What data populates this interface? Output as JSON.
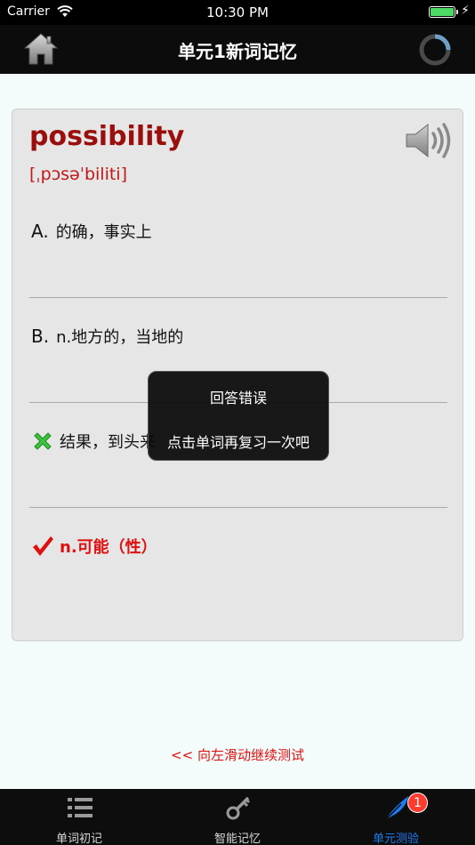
{
  "status_bar": {
    "carrier": "Carrier",
    "time": "10:30 PM",
    "charging_glyph": "⚡"
  },
  "nav": {
    "title": "单元1新词记忆",
    "home_icon": "house-icon",
    "progress_icon": "progress-ring-icon"
  },
  "card": {
    "word": "possibility",
    "phonetic": "[ˌpɔsəˈbiliti]",
    "speaker_icon": "speaker-icon",
    "options": [
      {
        "letter": "A.",
        "text": "的确，事实上",
        "state": "normal"
      },
      {
        "letter": "B.",
        "text": "n.地方的，当地的",
        "state": "normal"
      },
      {
        "letter": "",
        "text": "结果，到头来",
        "state": "wrong",
        "mark_icon": "wrong-cross-icon"
      },
      {
        "letter": "",
        "text": "n.可能（性）",
        "state": "correct",
        "mark_icon": "correct-check-icon"
      }
    ]
  },
  "toast": {
    "title": "回答错误",
    "message": "点击单词再复习一次吧"
  },
  "swipe_hint": "<< 向左滑动继续测试",
  "tabs": [
    {
      "label": "单词初记",
      "icon": "list-icon",
      "active": false
    },
    {
      "label": "智能记忆",
      "icon": "key-icon",
      "active": false
    },
    {
      "label": "单元测验",
      "icon": "feather-icon",
      "active": true,
      "badge": "1"
    }
  ],
  "colors": {
    "accent_red": "#e01010",
    "word_red": "#9b0e0e",
    "tab_active": "#1e7bf0",
    "battery_green": "#4cd964"
  }
}
